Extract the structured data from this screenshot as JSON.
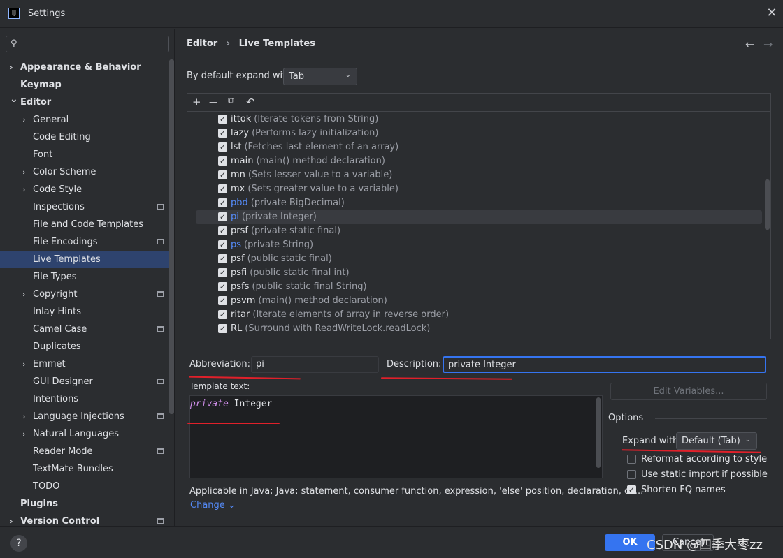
{
  "window": {
    "title": "Settings",
    "app_icon_text": "IJ"
  },
  "search": {
    "placeholder": ""
  },
  "sidebar": {
    "items": [
      {
        "label": "Appearance & Behavior",
        "chevron": "›",
        "bold": true,
        "indent": 0
      },
      {
        "label": "Keymap",
        "chevron": "",
        "bold": true,
        "indent": 0
      },
      {
        "label": "Editor",
        "chevron": "⌄",
        "bold": true,
        "indent": 0
      },
      {
        "label": "General",
        "chevron": "›",
        "indent": 1
      },
      {
        "label": "Code Editing",
        "chevron": "",
        "indent": 1
      },
      {
        "label": "Font",
        "chevron": "",
        "indent": 1
      },
      {
        "label": "Color Scheme",
        "chevron": "›",
        "indent": 1
      },
      {
        "label": "Code Style",
        "chevron": "›",
        "indent": 1
      },
      {
        "label": "Inspections",
        "chevron": "",
        "indent": 1,
        "project": true
      },
      {
        "label": "File and Code Templates",
        "chevron": "",
        "indent": 1
      },
      {
        "label": "File Encodings",
        "chevron": "",
        "indent": 1,
        "project": true
      },
      {
        "label": "Live Templates",
        "chevron": "",
        "indent": 1,
        "selected": true
      },
      {
        "label": "File Types",
        "chevron": "",
        "indent": 1
      },
      {
        "label": "Copyright",
        "chevron": "›",
        "indent": 1,
        "project": true
      },
      {
        "label": "Inlay Hints",
        "chevron": "",
        "indent": 1
      },
      {
        "label": "Camel Case",
        "chevron": "",
        "indent": 1,
        "project": true
      },
      {
        "label": "Duplicates",
        "chevron": "",
        "indent": 1
      },
      {
        "label": "Emmet",
        "chevron": "›",
        "indent": 1
      },
      {
        "label": "GUI Designer",
        "chevron": "",
        "indent": 1,
        "project": true
      },
      {
        "label": "Intentions",
        "chevron": "",
        "indent": 1
      },
      {
        "label": "Language Injections",
        "chevron": "›",
        "indent": 1,
        "project": true
      },
      {
        "label": "Natural Languages",
        "chevron": "›",
        "indent": 1
      },
      {
        "label": "Reader Mode",
        "chevron": "",
        "indent": 1,
        "project": true
      },
      {
        "label": "TextMate Bundles",
        "chevron": "",
        "indent": 1
      },
      {
        "label": "TODO",
        "chevron": "",
        "indent": 1
      },
      {
        "label": "Plugins",
        "chevron": "",
        "bold": true,
        "indent": 0
      },
      {
        "label": "Version Control",
        "chevron": "›",
        "bold": true,
        "indent": 0,
        "project": true
      }
    ]
  },
  "header": {
    "breadcrumb_root": "Editor",
    "breadcrumb_sep": "›",
    "breadcrumb_current": "Live Templates",
    "back_icon": "←",
    "forward_icon": "→"
  },
  "expand_default": {
    "label": "By default expand with",
    "value": "Tab"
  },
  "toolbar": {
    "add": "+",
    "remove": "—",
    "copy": "⧉",
    "restore": "↶"
  },
  "templates": [
    {
      "abbr": "ittok",
      "desc": "(Iterate tokens from String)"
    },
    {
      "abbr": "lazy",
      "desc": "(Performs lazy initialization)"
    },
    {
      "abbr": "lst",
      "desc": "(Fetches last element of an array)"
    },
    {
      "abbr": "main",
      "desc": "(main() method declaration)"
    },
    {
      "abbr": "mn",
      "desc": "(Sets lesser value to a variable)"
    },
    {
      "abbr": "mx",
      "desc": "(Sets greater value to a variable)"
    },
    {
      "abbr": "pbd",
      "desc": "(private BigDecimal)",
      "custom": true
    },
    {
      "abbr": "pi",
      "desc": "(private Integer)",
      "custom": true,
      "selected": true
    },
    {
      "abbr": "prsf",
      "desc": "(private static final)"
    },
    {
      "abbr": "ps",
      "desc": "(private String)",
      "custom": true
    },
    {
      "abbr": "psf",
      "desc": "(public static final)"
    },
    {
      "abbr": "psfi",
      "desc": "(public static final int)"
    },
    {
      "abbr": "psfs",
      "desc": "(public static final String)"
    },
    {
      "abbr": "psvm",
      "desc": "(main() method declaration)"
    },
    {
      "abbr": "ritar",
      "desc": "(Iterate elements of array in reverse order)"
    },
    {
      "abbr": "RL",
      "desc": "(Surround with ReadWriteLock.readLock)"
    }
  ],
  "form": {
    "abbreviation_label": "Abbreviation:",
    "abbreviation_value": "pi",
    "description_label": "Description:",
    "description_value": "private Integer",
    "template_text_label": "Template text:",
    "template_keyword": "private",
    "template_rest": " Integer",
    "edit_variables_label": "Edit Variables...",
    "applicable_text": "Applicable in Java; Java: statement, consumer function, expression, 'else' position, declaration, co...",
    "change_label": "Change ⌄"
  },
  "options": {
    "title": "Options",
    "expand_with_label": "Expand with",
    "expand_with_value": "Default (Tab)",
    "reformat_label": "Reformat according to style",
    "reformat_checked": false,
    "static_import_label": "Use static import if possible",
    "static_import_checked": false,
    "shorten_fq_label": "Shorten FQ names",
    "shorten_fq_checked": true
  },
  "footer": {
    "help": "?",
    "ok_label": "OK",
    "cancel_label": "Cancel",
    "watermark": "CSDN @四季大枣zz"
  },
  "colors": {
    "accent": "#3574f0",
    "selection": "#2e436e",
    "annotation_red": "#e0202a",
    "link": "#548af7"
  }
}
